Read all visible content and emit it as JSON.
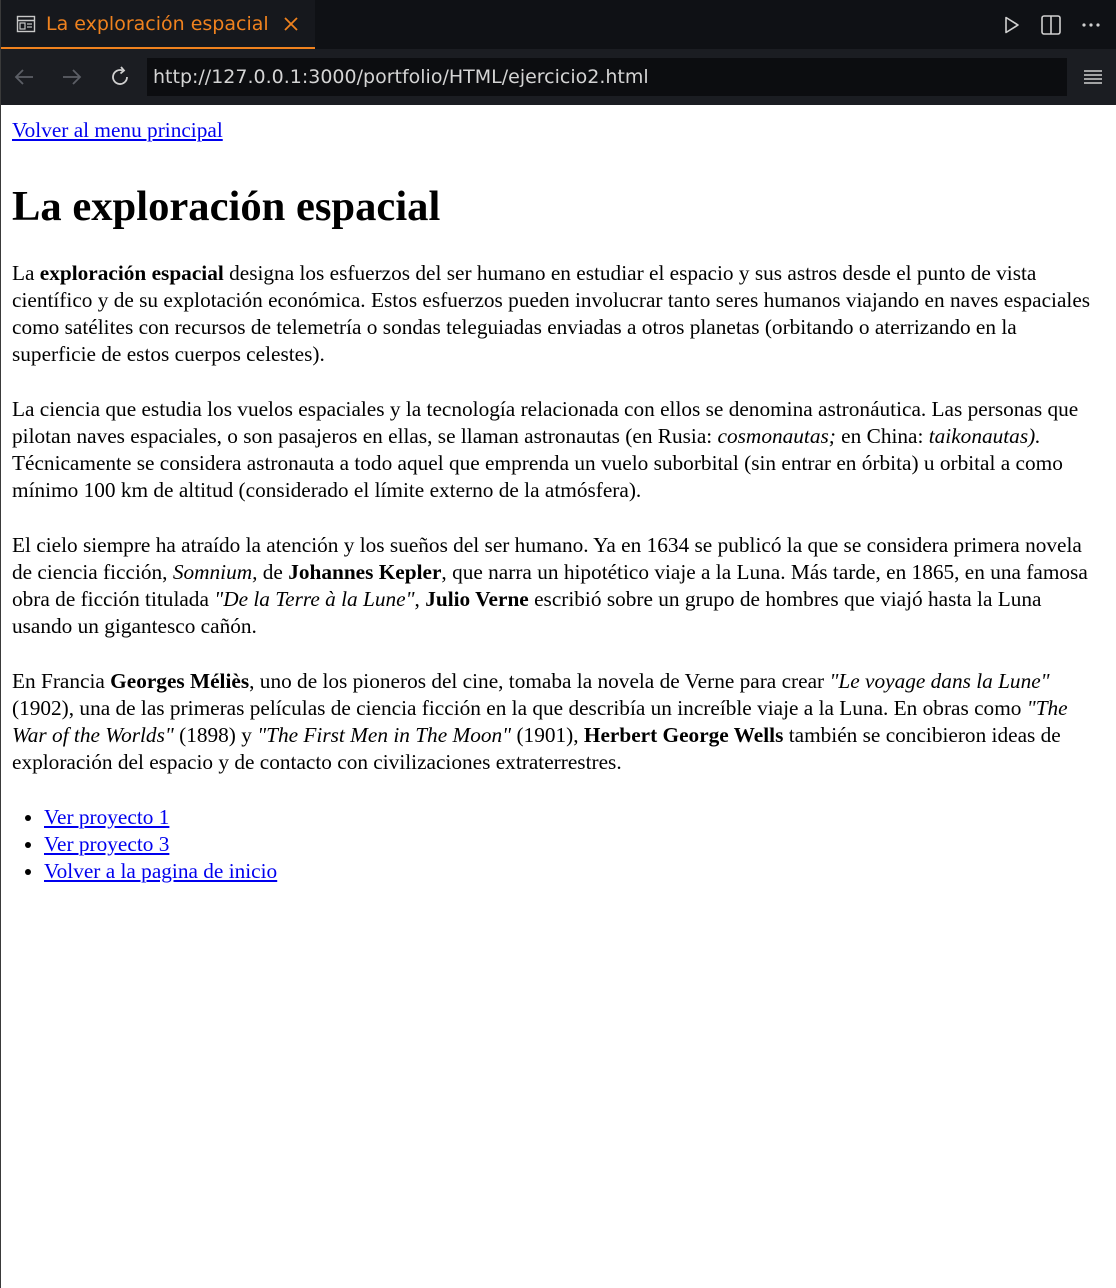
{
  "browser": {
    "tab_title": "La exploración espacial",
    "url": "http://127.0.0.1:3000/portfolio/HTML/ejercicio2.html",
    "accent_color": "#f0821e",
    "icons": [
      "page-icon",
      "close-icon",
      "run-icon",
      "split-view-icon",
      "more-icon",
      "back-icon",
      "forward-icon",
      "reload-icon",
      "menu-icon"
    ]
  },
  "page": {
    "back_link": "Volver al menu principal",
    "title": "La exploración espacial",
    "p1": {
      "t1": "La ",
      "b1": "exploración espacial",
      "t2": " designa los esfuerzos del ser humano en estudiar el espacio y sus astros desde el punto de vista científico y de su explotación económica. Estos esfuerzos pueden involucrar tanto seres humanos viajando en naves espaciales como satélites con recursos de telemetría o sondas teleguiadas enviadas a otros planetas (orbitando o aterrizando en la superficie de estos cuerpos celestes)."
    },
    "p2": {
      "t1": "La ciencia que estudia los vuelos espaciales y la tecnología relacionada con ellos se denomina astronáutica. Las personas que pilotan naves espaciales, o son pasajeros en ellas, se llaman astronautas (en Rusia: ",
      "i1": "cosmonautas;",
      "t2": " en China: ",
      "i2": "taikonautas).",
      "t3": " Técnicamente se considera astronauta a todo aquel que emprenda un vuelo suborbital (sin entrar en órbita) u orbital a como mínimo 100 km de altitud (considerado el límite externo de la atmósfera)."
    },
    "p3": {
      "t1": "El cielo siempre ha atraído la atención y los sueños del ser humano. Ya en 1634 se publicó la que se considera primera novela de ciencia ficción, ",
      "i1": "Somnium,",
      "t2": " de ",
      "b1": "Johannes Kepler",
      "t3": ", que narra un hipotético viaje a la Luna. Más tarde, en 1865, en una famosa obra de ficción titulada ",
      "i2": "\"De la Terre à la Lune\"",
      "t4": ", ",
      "b2": "Julio Verne",
      "t5": " escribió sobre un grupo de hombres que viajó hasta la Luna usando un gigantesco cañón."
    },
    "p4": {
      "t1": "En Francia ",
      "b1": "Georges Méliès",
      "t2": ", uno de los pioneros del cine, tomaba la novela de Verne para crear ",
      "i1": "\"Le voyage dans la Lune\"",
      "t3": " (1902), una de las primeras películas de ciencia ficción en la que describía un increíble viaje a la Luna. En obras como ",
      "i2": "\"The War of the Worlds\"",
      "t4": " (1898) y ",
      "i3": "\"The First Men in The Moon\"",
      "t5": " (1901), ",
      "b2": "Herbert George Wells",
      "t6": " también se concibieron ideas de exploración del espacio y de contacto con civilizaciones extraterrestres."
    },
    "links": [
      "Ver proyecto 1",
      "Ver proyecto 3",
      "Volver a la pagina de inicio"
    ]
  }
}
